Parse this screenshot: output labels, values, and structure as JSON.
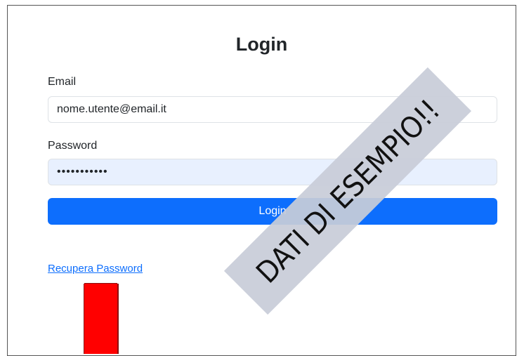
{
  "form": {
    "title": "Login",
    "email_label": "Email",
    "email_value": "nome.utente@email.it",
    "password_label": "Password",
    "password_value": "•••••••••••",
    "login_button": "Login",
    "recover_link": "Recupera Password"
  },
  "overlay": {
    "watermark_text": "DATI DI ESEMPIO!!"
  },
  "colors": {
    "primary": "#0d6efd",
    "autofill_background": "#e8f0fe",
    "marker": "#ff0000",
    "watermark_band": "#c8ccd8"
  }
}
